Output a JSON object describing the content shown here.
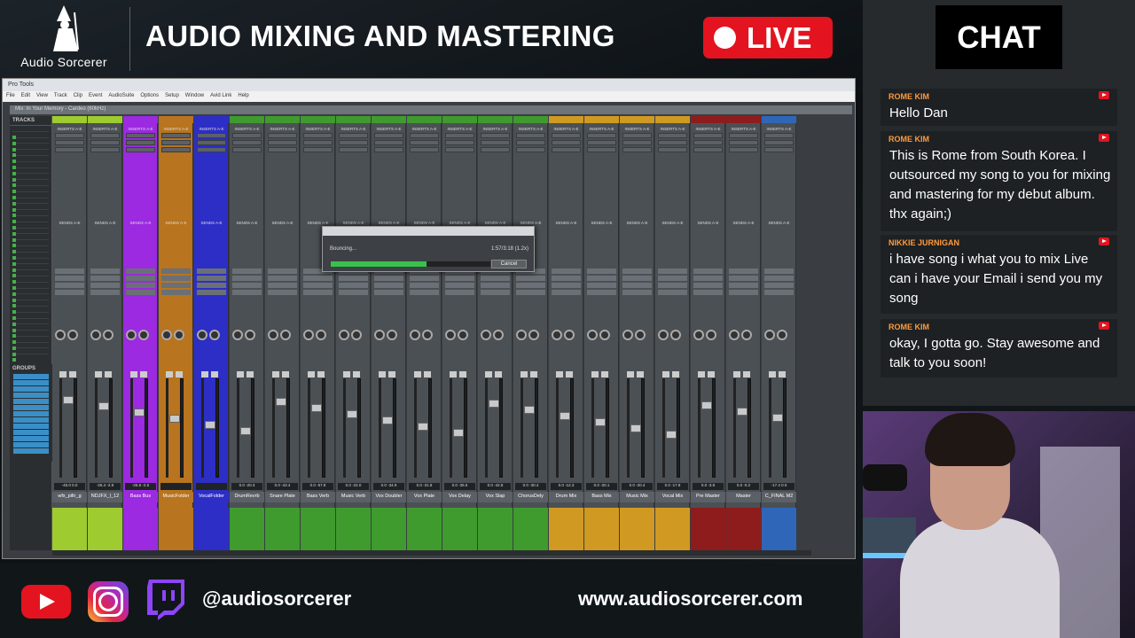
{
  "brand": {
    "name": "Audio Sorcerer"
  },
  "header": {
    "title": "AUDIO MIXING AND MASTERING",
    "live_label": "LIVE"
  },
  "daw": {
    "app_title": "Pro Tools",
    "menu": [
      "File",
      "Edit",
      "View",
      "Track",
      "Clip",
      "Event",
      "AudioSuite",
      "Options",
      "Setup",
      "Window",
      "Avid Link",
      "Help"
    ],
    "session_title": "Mix: In Your Memory - Cardeo (60kHz)",
    "tracks_label": "TRACKS",
    "groups_label": "GROUPS",
    "bounce": {
      "status": "Bouncing...",
      "time": "1:57/3:18 (1.2x)",
      "cancel_label": "Cancel",
      "progress": 0.6
    },
    "strips": [
      {
        "name": "wfx_piltr_g",
        "color": "#9ecb2f",
        "vals": "-45.0  0.0"
      },
      {
        "name": "NDJFX_I_12",
        "color": "#9ecb2f",
        "vals": "-26.4  -2.9"
      },
      {
        "name": "Bass Bus",
        "color": "#9b2ae0",
        "vals": "-25.5  -2.5"
      },
      {
        "name": "MusicFolder",
        "color": "#b8741e",
        "vals": ""
      },
      {
        "name": "VocalFolder",
        "color": "#2d2ec6",
        "vals": ""
      },
      {
        "name": "DrumRevrb",
        "color": "#3f9b2e",
        "vals": "0.0  -20.3"
      },
      {
        "name": "Snare Plate",
        "color": "#3f9b2e",
        "vals": "0.0  -43.4"
      },
      {
        "name": "Bass Verb",
        "color": "#3f9b2e",
        "vals": "0.0  -57.8"
      },
      {
        "name": "Music Verb",
        "color": "#3f9b2e",
        "vals": "0.0  -22.0"
      },
      {
        "name": "Vox Doubler",
        "color": "#3f9b2e",
        "vals": "0.0  -34.9"
      },
      {
        "name": "Vox Plate",
        "color": "#3f9b2e",
        "vals": "0.0  -31.8"
      },
      {
        "name": "Vox Delay",
        "color": "#3f9b2e",
        "vals": "0.0  -35.5"
      },
      {
        "name": "Vox Slap",
        "color": "#3f9b2e",
        "vals": "0.0  -42.8"
      },
      {
        "name": "ChorusDely",
        "color": "#3f9b2e",
        "vals": "0.0  -30.4"
      },
      {
        "name": "Drum Mix",
        "color": "#d09a22",
        "vals": "0.0  -12.3"
      },
      {
        "name": "Bass Mix",
        "color": "#d09a22",
        "vals": "0.0  -20.1"
      },
      {
        "name": "Music Mix",
        "color": "#d09a22",
        "vals": "0.0  -20.4"
      },
      {
        "name": "Vocal Mix",
        "color": "#d09a22",
        "vals": "0.0  -17.8"
      },
      {
        "name": "Pre Master",
        "color": "#8e1c1c",
        "vals": "0.0  -3.9"
      },
      {
        "name": "Master",
        "color": "#8e1c1c",
        "vals": "0.0  -0.2"
      },
      {
        "name": "C_FINAL M2",
        "color": "#2f66b8",
        "vals": "-17.4  0.0"
      }
    ]
  },
  "chat": {
    "title": "CHAT",
    "messages": [
      {
        "user": "ROME KIM",
        "text": "Hello Dan"
      },
      {
        "user": "ROME KIM",
        "text": "This is Rome from South Korea. I outsourced my song to you for mixing and mastering for my debut album. thx again;)"
      },
      {
        "user": "NIKKIE JURNIGAN",
        "text": "i have song i what you to mix Live can i have your Email i send you my song"
      },
      {
        "user": "ROME KIM",
        "text": "okay, I gotta go. Stay awesome and talk to you soon!"
      }
    ]
  },
  "footer": {
    "handle": "@audiosorcerer",
    "website": "www.audiosorcerer.com"
  },
  "icons": [
    "wizard-logo-icon",
    "youtube-icon",
    "instagram-icon",
    "twitch-icon",
    "live-dot-icon"
  ]
}
